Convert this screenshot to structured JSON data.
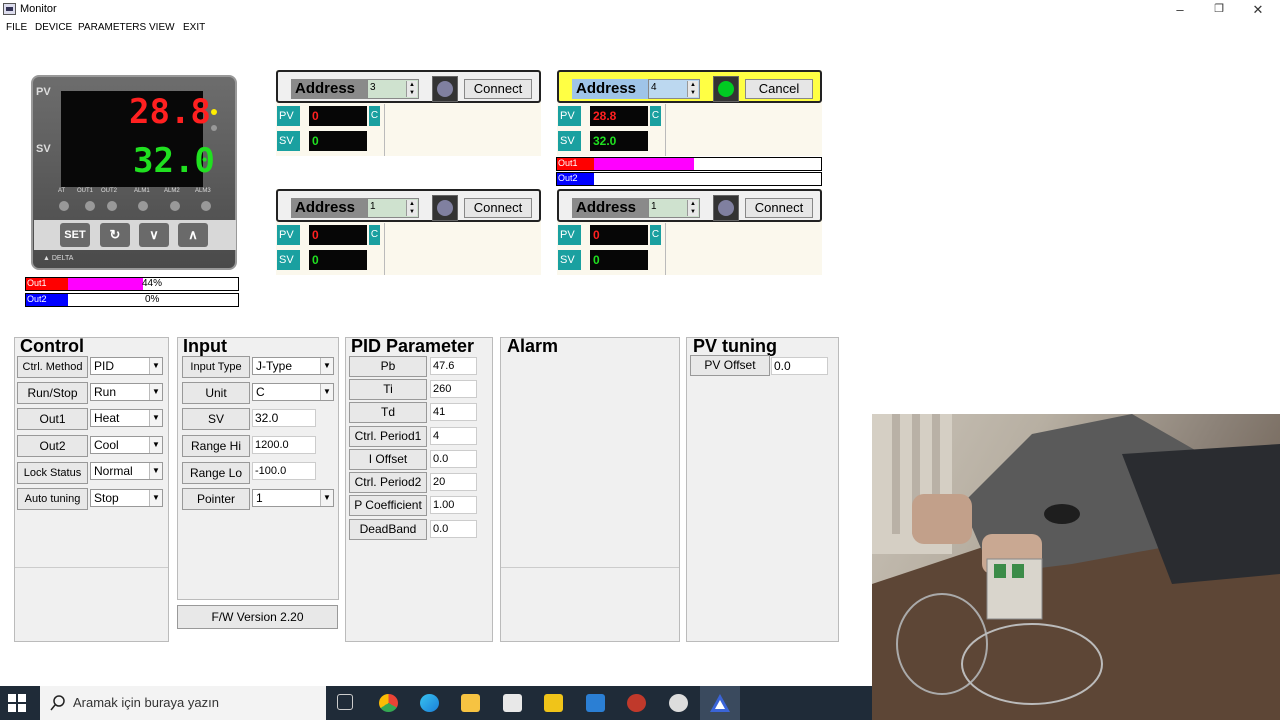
{
  "window": {
    "title": "Monitor",
    "minimize": "–",
    "restore": "❐",
    "close": "✕"
  },
  "menu": [
    "FILE",
    "DEVICE",
    "PARAMETERS",
    "VIEW",
    "EXIT"
  ],
  "device": {
    "pv_label": "PV",
    "sv_label": "SV",
    "pv_value": "28.8",
    "sv_value": "32.0",
    "indicators": [
      "AT",
      "OUT1",
      "OUT2",
      "ALM1",
      "ALM2",
      "ALM3"
    ],
    "keys": [
      "SET",
      "↻",
      "∨",
      "∧"
    ],
    "brand": "▲ DELTA"
  },
  "outputs": [
    {
      "name": "Out1",
      "percent": 44,
      "label": "44%",
      "color": "#ff00ff"
    },
    {
      "name": "Out2",
      "percent": 0,
      "label": "0%",
      "color": "#0000ff"
    }
  ],
  "addresses": [
    {
      "label": "Address",
      "value": "3",
      "button": "Connect",
      "pv_tag": "PV",
      "sv_tag": "SV",
      "pv": "0",
      "sv": "0",
      "unit": "C",
      "active": false
    },
    {
      "label": "Address",
      "value": "4",
      "button": "Cancel",
      "pv_tag": "PV",
      "sv_tag": "SV",
      "pv": "28.8",
      "sv": "32.0",
      "unit": "C",
      "active": true,
      "out1": {
        "name": "Out1",
        "percent": 44
      },
      "out2": {
        "name": "Out2",
        "percent": 0
      }
    },
    {
      "label": "Address",
      "value": "1",
      "button": "Connect",
      "pv_tag": "PV",
      "sv_tag": "SV",
      "pv": "0",
      "sv": "0",
      "unit": "C",
      "active": false
    },
    {
      "label": "Address",
      "value": "1",
      "button": "Connect",
      "pv_tag": "PV",
      "sv_tag": "SV",
      "pv": "0",
      "sv": "0",
      "unit": "C",
      "active": false
    }
  ],
  "control": {
    "title": "Control",
    "rows": [
      {
        "label": "Ctrl. Method",
        "value": "PID"
      },
      {
        "label": "Run/Stop",
        "value": "Run"
      },
      {
        "label": "Out1",
        "value": "Heat"
      },
      {
        "label": "Out2",
        "value": "Cool"
      },
      {
        "label": "Lock Status",
        "value": "Normal"
      },
      {
        "label": "Auto tuning",
        "value": "Stop"
      }
    ]
  },
  "input": {
    "title": "Input",
    "rows": [
      {
        "label": "Input Type",
        "value": "J-Type"
      },
      {
        "label": "Unit",
        "value": "C"
      },
      {
        "label": "SV",
        "value": "32.0"
      },
      {
        "label": "Range Hi",
        "value": "1200.0"
      },
      {
        "label": "Range Lo",
        "value": "-100.0"
      },
      {
        "label": "Pointer",
        "value": "1"
      }
    ],
    "fw_version": "F/W Version 2.20"
  },
  "pid": {
    "title": "PID Parameter",
    "rows": [
      {
        "label": "Pb",
        "value": "47.6"
      },
      {
        "label": "Ti",
        "value": "260"
      },
      {
        "label": "Td",
        "value": "41"
      },
      {
        "label": "Ctrl. Period1",
        "value": "4"
      },
      {
        "label": "I Offset",
        "value": "0.0"
      },
      {
        "label": "Ctrl. Period2",
        "value": "20"
      },
      {
        "label": "P Coefficient",
        "value": "1.00"
      },
      {
        "label": "DeadBand",
        "value": "0.0"
      }
    ]
  },
  "alarm": {
    "title": "Alarm"
  },
  "pvtuning": {
    "title": "PV tuning",
    "label": "PV Offset",
    "value": "0.0"
  },
  "taskbar": {
    "search_placeholder": "Aramak için buraya yazın"
  }
}
